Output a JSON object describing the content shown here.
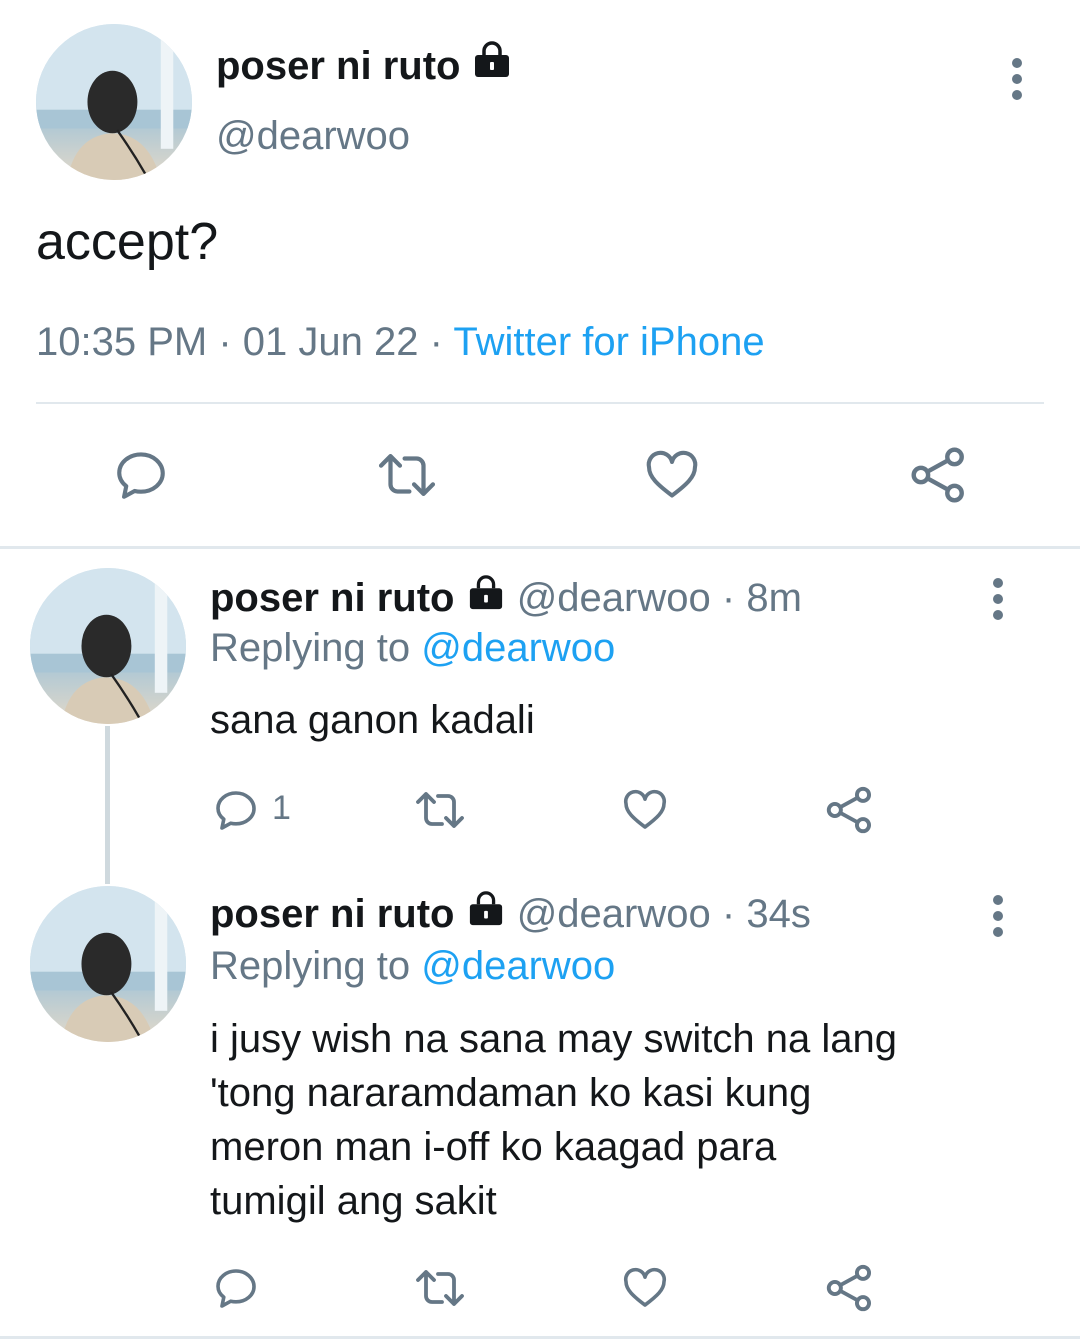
{
  "main_tweet": {
    "display_name": "poser ni ruto",
    "handle": "@dearwoo",
    "text": "accept?",
    "time": "10:35 PM",
    "separator": "·",
    "date": "01 Jun 22",
    "source": "Twitter for iPhone"
  },
  "replies": [
    {
      "display_name": "poser ni ruto",
      "handle": "@dearwoo",
      "separator": "·",
      "age": "8m",
      "replying_prefix": "Replying to",
      "replying_to": "@dearwoo",
      "text": "sana ganon kadali",
      "reply_count": "1"
    },
    {
      "display_name": "poser ni ruto",
      "handle": "@dearwoo",
      "separator": "·",
      "age": "34s",
      "replying_prefix": "Replying to",
      "replying_to": "@dearwoo",
      "text_lines": [
        "i jusy wish na sana may switch na lang",
        "'tong nararamdaman ko kasi kung",
        "meron man i-off ko kaagad para",
        "tumigil ang sakit"
      ],
      "reply_count": ""
    }
  ],
  "icons": {
    "reply": "speech-bubble-icon",
    "retweet": "retweet-icon",
    "like": "heart-icon",
    "share": "share-icon",
    "more": "more-vertical-icon",
    "protected": "lock-icon"
  },
  "colors": {
    "text": "#14171a",
    "muted": "#657786",
    "link": "#1da1f2",
    "divider": "#e1e8ed"
  }
}
